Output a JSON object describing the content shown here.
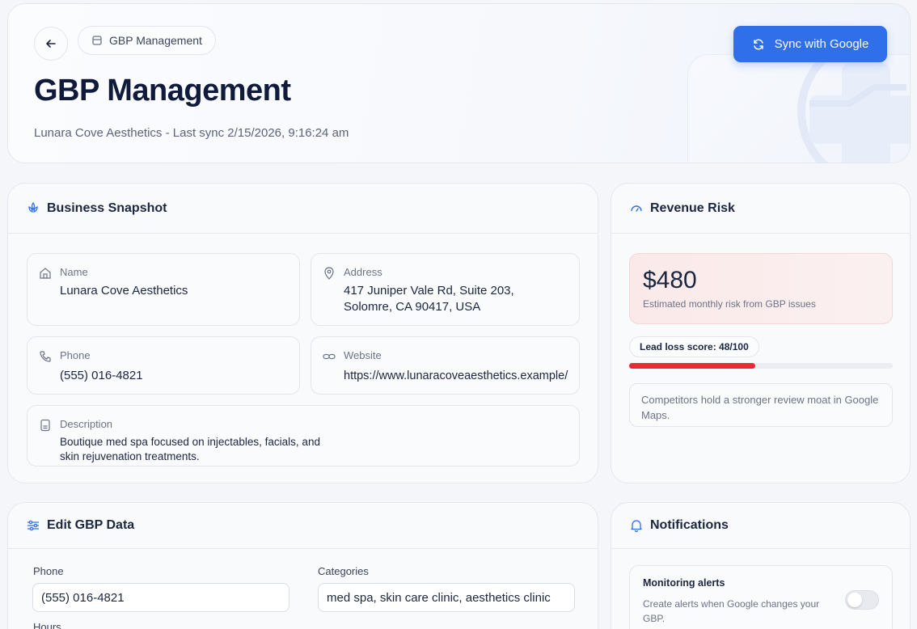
{
  "header": {
    "breadcrumb": "GBP Management",
    "title": "GBP Management",
    "subtitle": "Lunara Cove Aesthetics - Last sync 2/15/2026, 9:16:24 am",
    "sync_label": "Sync with Google"
  },
  "snapshot": {
    "title": "Business Snapshot",
    "name_label": "Name",
    "name_value": "Lunara Cove Aesthetics",
    "address_label": "Address",
    "address_line1": "417 Juniper Vale Rd, Suite 203,",
    "address_line2": "Solomre, CA 90417, USA",
    "phone_label": "Phone",
    "phone_value": "(555) 016-4821",
    "website_label": "Website",
    "website_value": "https://www.lunaracoveaesthetics.example/",
    "description_label": "Description",
    "description_line1": "Boutique med spa focused on injectables, facials, and",
    "description_line2": "skin rejuvenation treatments."
  },
  "risk": {
    "title": "Revenue Risk",
    "amount": "$480",
    "amount_desc": "Estimated monthly risk from GBP issues",
    "score_label": "Lead loss score: 48/100",
    "score_value": 48,
    "score_max": 100,
    "note": "Competitors hold a stronger review moat in Google Maps."
  },
  "edit": {
    "title": "Edit GBP Data",
    "phone_label": "Phone",
    "phone_value": "(555) 016-4821",
    "categories_label": "Categories",
    "categories_value": "med spa, skin care clinic, aesthetics clinic",
    "hours_label": "Hours"
  },
  "notifications": {
    "title": "Notifications",
    "monitor_title": "Monitoring alerts",
    "monitor_desc_line1": "Create alerts when Google changes your",
    "monitor_desc_line2": "GBP.",
    "monitor_enabled": false
  },
  "colors": {
    "accent": "#2f6fea",
    "danger": "#ec2a35",
    "title": "#101a3a"
  }
}
